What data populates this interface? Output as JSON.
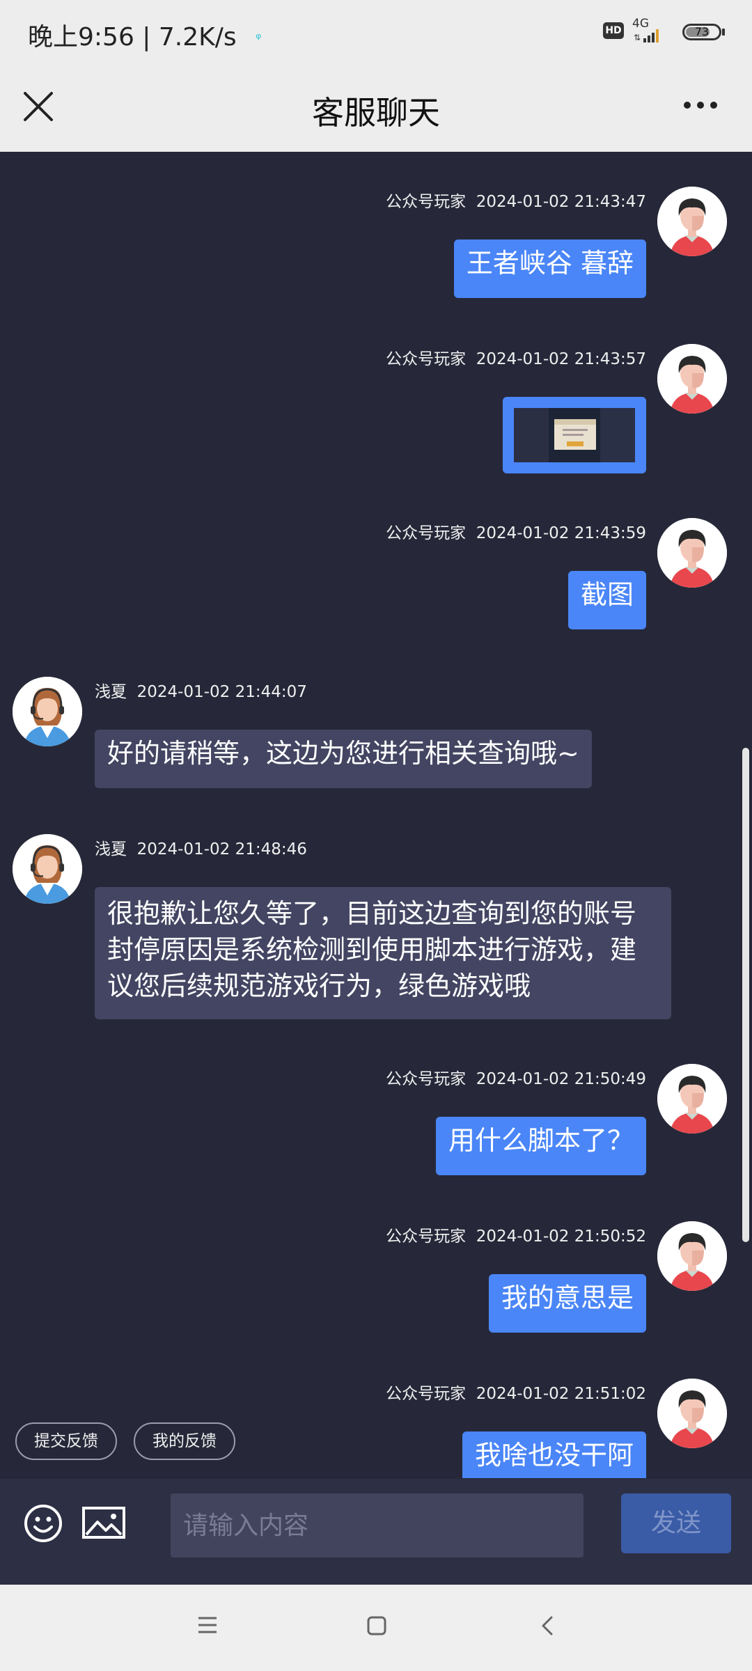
{
  "status_bar": {
    "time": "晚上9:56",
    "separator": "|",
    "net_speed": "7.2K/s",
    "hd": "HD",
    "network": "4G",
    "battery": "73"
  },
  "header": {
    "title": "客服聊天",
    "close_icon": "close-icon",
    "more_icon": "more-dots-icon"
  },
  "messages": [
    {
      "side": "right",
      "sender": "公众号玩家",
      "time": "2024-01-02 21:43:47",
      "text": "王者峡谷 暮辞"
    },
    {
      "side": "right",
      "sender": "公众号玩家",
      "time": "2024-01-02 21:43:57",
      "type": "image"
    },
    {
      "side": "right",
      "sender": "公众号玩家",
      "time": "2024-01-02 21:43:59",
      "text": "截图"
    },
    {
      "side": "left",
      "sender": "浅夏",
      "time": "2024-01-02 21:44:07",
      "text": "好的请稍等，这边为您进行相关查询哦~"
    },
    {
      "side": "left",
      "sender": "浅夏",
      "time": "2024-01-02 21:48:46",
      "lines": [
        "很抱歉让您久等了，目前这边查询到您的账号",
        "封停原因是系统检测到使用脚本进行游戏，建",
        "议您后续规范游戏行为，绿色游戏哦"
      ]
    },
    {
      "side": "right",
      "sender": "公众号玩家",
      "time": "2024-01-02 21:50:49",
      "text": "用什么脚本了？"
    },
    {
      "side": "right",
      "sender": "公众号玩家",
      "time": "2024-01-02 21:50:52",
      "text": "我的意思是"
    },
    {
      "side": "right",
      "sender": "公众号玩家",
      "time": "2024-01-02 21:51:02",
      "text": "我啥也没干阿"
    }
  ],
  "quick_actions": {
    "submit_feedback": "提交反馈",
    "my_feedback": "我的反馈"
  },
  "input_bar": {
    "placeholder": "请输入内容",
    "value": "",
    "send_label": "发送",
    "emoji_icon": "emoji-icon",
    "picture_icon": "picture-icon"
  },
  "nav_bar": {
    "menu_icon": "menu-icon",
    "home_icon": "home-square-icon",
    "back_icon": "back-chevron-icon"
  },
  "colors": {
    "chat_bg": "#262839",
    "user_bubble": "#4a86f7",
    "agent_bubble": "#434562",
    "header_bg": "#ededed",
    "send_button": "#3a5ba6"
  }
}
